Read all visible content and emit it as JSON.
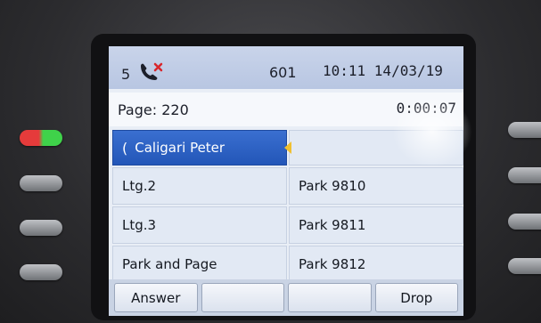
{
  "status_bar": {
    "missed_count": "5",
    "missed_icon": "missed-call-icon",
    "extension": "601",
    "clock": "10:11 14/03/19"
  },
  "page_line": {
    "label": "Page: 220",
    "timer": "0:00:07"
  },
  "lines": [
    {
      "label": "Caligari Peter",
      "icon": "handset-icon",
      "active": true
    },
    {
      "label": ""
    },
    {
      "label": "Ltg.2"
    },
    {
      "label": "Park 9810"
    },
    {
      "label": "Ltg.3"
    },
    {
      "label": "Park 9811"
    },
    {
      "label": "Park and Page"
    },
    {
      "label": "Park 9812"
    }
  ],
  "softkeys": [
    "Answer",
    "",
    "",
    "Drop"
  ],
  "colors": {
    "active_line": "#2356b8",
    "led_red": "#e53b3b",
    "led_green": "#3fd24a"
  }
}
